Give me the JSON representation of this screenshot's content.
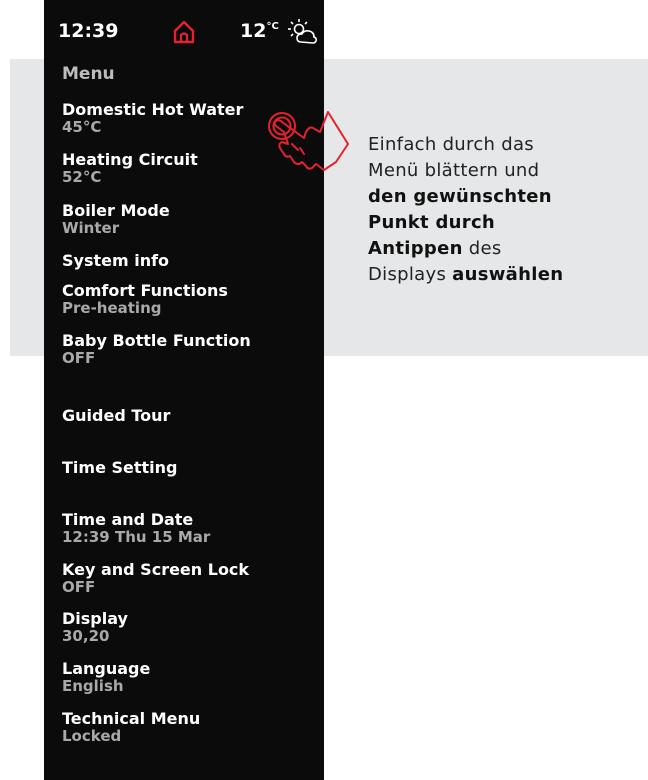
{
  "status_bar": {
    "time": "12:39",
    "temperature": "12",
    "temperature_unit": "°C",
    "home_icon": "home-icon",
    "weather_icon": "sun-cloud-icon",
    "accent_color": "#e4222f"
  },
  "menu": {
    "title": "Menu",
    "items": [
      {
        "label": "Domestic Hot Water",
        "value": "45°C"
      },
      {
        "label": "Heating Circuit",
        "value": "52°C"
      },
      {
        "label": "Boiler Mode",
        "value": "Winter"
      },
      {
        "label": "System info",
        "value": ""
      },
      {
        "label": "Comfort Functions",
        "value": "Pre-heating"
      },
      {
        "label": "Baby Bottle Function",
        "value": "OFF"
      },
      {
        "label": "Guided Tour",
        "value": ""
      },
      {
        "label": "Time Setting",
        "value": ""
      },
      {
        "label": "Time and Date",
        "value": "12:39  Thu 15 Mar"
      },
      {
        "label": "Key and Screen Lock",
        "value": "OFF"
      },
      {
        "label": "Display",
        "value": "30,20"
      },
      {
        "label": "Language",
        "value": "English"
      },
      {
        "label": "Technical Menu",
        "value": "Locked"
      }
    ]
  },
  "callout": {
    "line1": "Einfach durch das",
    "line2": "Menü blättern und",
    "line3_bold": "den gewünschten",
    "line4_bold": "Punkt durch",
    "line5_bold": "Antippen",
    "line5_rest": " des",
    "line6_plain": "Displays ",
    "line6_bold": "auswählen"
  }
}
